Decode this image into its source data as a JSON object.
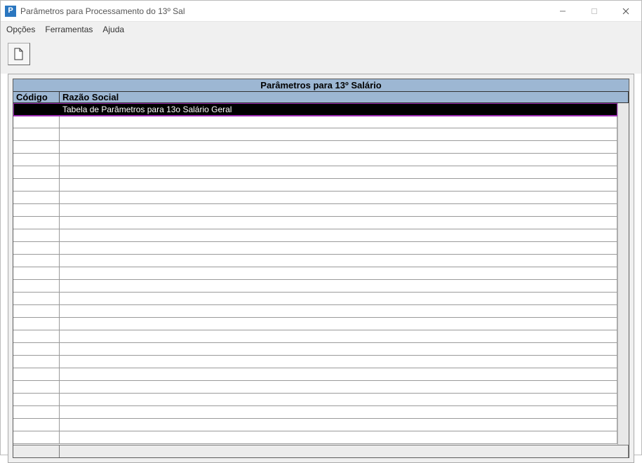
{
  "window": {
    "title": "Parâmetros para Processamento do 13º Sal",
    "app_icon_letter": "P"
  },
  "menu": {
    "opcoes": "Opções",
    "ferramentas": "Ferramentas",
    "ajuda": "Ajuda"
  },
  "grid": {
    "title": "Parâmetros para 13º Salário",
    "columns": {
      "codigo": "Código",
      "razao": "Razão Social"
    },
    "rows": [
      {
        "codigo": "",
        "razao": "Tabela de Parâmetros para 13o Salário Geral",
        "selected": true
      }
    ],
    "empty_row_count": 26
  },
  "colors": {
    "header_bg": "#9db7d3",
    "selection_bg": "#000000",
    "selection_border": "#9c2db3"
  }
}
